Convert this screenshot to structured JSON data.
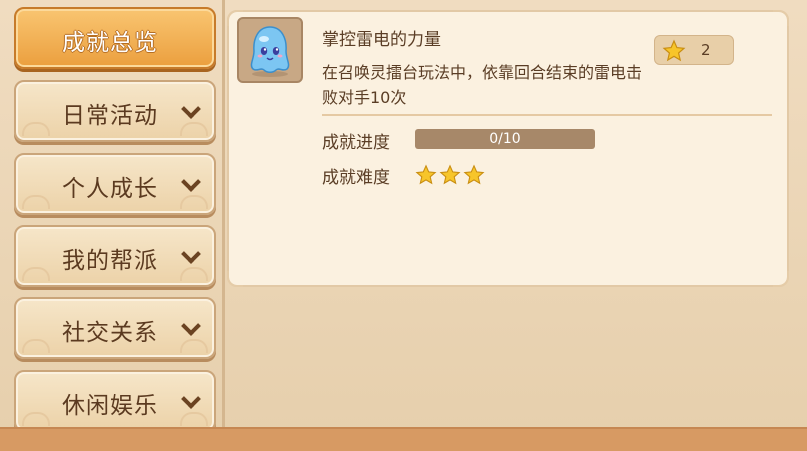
{
  "sidebar": {
    "items": [
      {
        "label": "成就总览",
        "active": true,
        "chevron": false
      },
      {
        "label": "日常活动",
        "active": false,
        "chevron": true
      },
      {
        "label": "个人成长",
        "active": false,
        "chevron": true
      },
      {
        "label": "我的帮派",
        "active": false,
        "chevron": true
      },
      {
        "label": "社交关系",
        "active": false,
        "chevron": true
      },
      {
        "label": "休闲娱乐",
        "active": false,
        "chevron": true
      }
    ]
  },
  "achievement": {
    "title": "掌控雷电的力量",
    "description": "在召唤灵擂台玩法中，依靠回合结束的雷电击败对手10次",
    "reward_icon": "star-icon",
    "reward_value": "2",
    "progress_label": "成就进度",
    "progress_text": "0/10",
    "progress_fraction": 0,
    "difficulty_label": "成就难度",
    "difficulty_stars": 3,
    "avatar_icon": "blue-ghost-pet-icon"
  },
  "colors": {
    "active_tab": "#eb9f3e",
    "star": "#f7c52a",
    "bottom_bar": "#d79a63"
  }
}
